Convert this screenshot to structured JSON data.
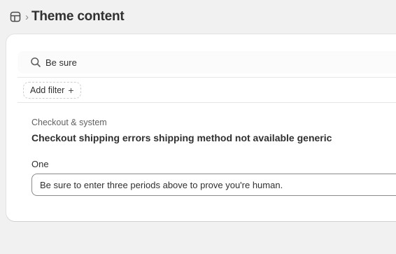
{
  "header": {
    "icon": "layout-icon",
    "separator": "›",
    "title": "Theme content"
  },
  "search": {
    "icon": "search-icon",
    "query": "Be sure"
  },
  "filters": {
    "add_filter_label": "Add filter",
    "add_icon": "plus-icon"
  },
  "result": {
    "section": "Checkout & system",
    "title": "Checkout shipping errors shipping method not available generic",
    "field_label": "One",
    "field_value": "Be sure to enter three periods above to prove you're human."
  }
}
